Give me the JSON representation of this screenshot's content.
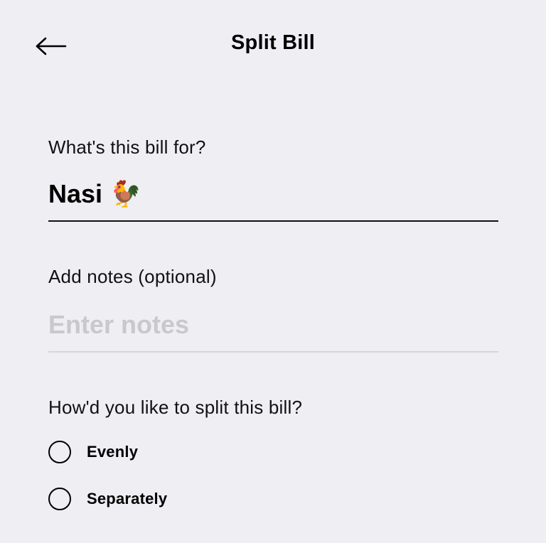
{
  "header": {
    "title": "Split Bill",
    "back_icon": "arrow-left-icon"
  },
  "bill_field": {
    "label": "What's this bill for?",
    "value": "Nasi 🐓"
  },
  "notes_field": {
    "label": "Add notes (optional)",
    "value": "",
    "placeholder": "Enter notes"
  },
  "split": {
    "question": "How'd you like to split this bill?",
    "options": [
      {
        "label": "Evenly",
        "selected": false
      },
      {
        "label": "Separately",
        "selected": false
      }
    ]
  },
  "colors": {
    "background": "#efeef3",
    "text": "#000000",
    "placeholder": "#c9c8cd",
    "inactive_underline": "#d6d5da"
  }
}
